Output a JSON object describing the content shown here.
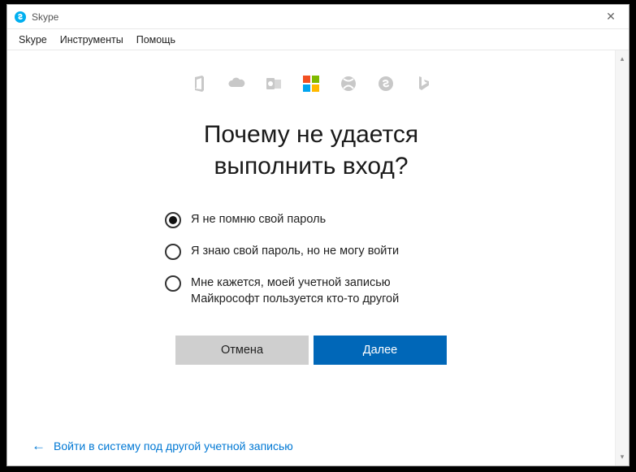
{
  "window": {
    "title": "Skype",
    "close_glyph": "✕"
  },
  "menubar": {
    "items": [
      "Skype",
      "Инструменты",
      "Помощь"
    ]
  },
  "brand_icons": {
    "office": "office-icon",
    "onedrive": "onedrive-icon",
    "outlook": "outlook-icon",
    "microsoft": "microsoft-logo-icon",
    "xbox": "xbox-icon",
    "skype": "skype-icon",
    "bing": "bing-icon"
  },
  "heading": {
    "line1": "Почему не удается",
    "line2": "выполнить вход?"
  },
  "options": [
    {
      "label": "Я не помню свой пароль",
      "checked": true
    },
    {
      "label": "Я знаю свой пароль, но не могу войти",
      "checked": false
    },
    {
      "label": "Мне кажется, моей учетной записью Майкрософт пользуется кто-то другой",
      "checked": false
    }
  ],
  "buttons": {
    "cancel": "Отмена",
    "next": "Далее"
  },
  "footer": {
    "link": "Войти в систему под другой учетной записью"
  },
  "scroll": {
    "up": "▴",
    "down": "▾"
  }
}
